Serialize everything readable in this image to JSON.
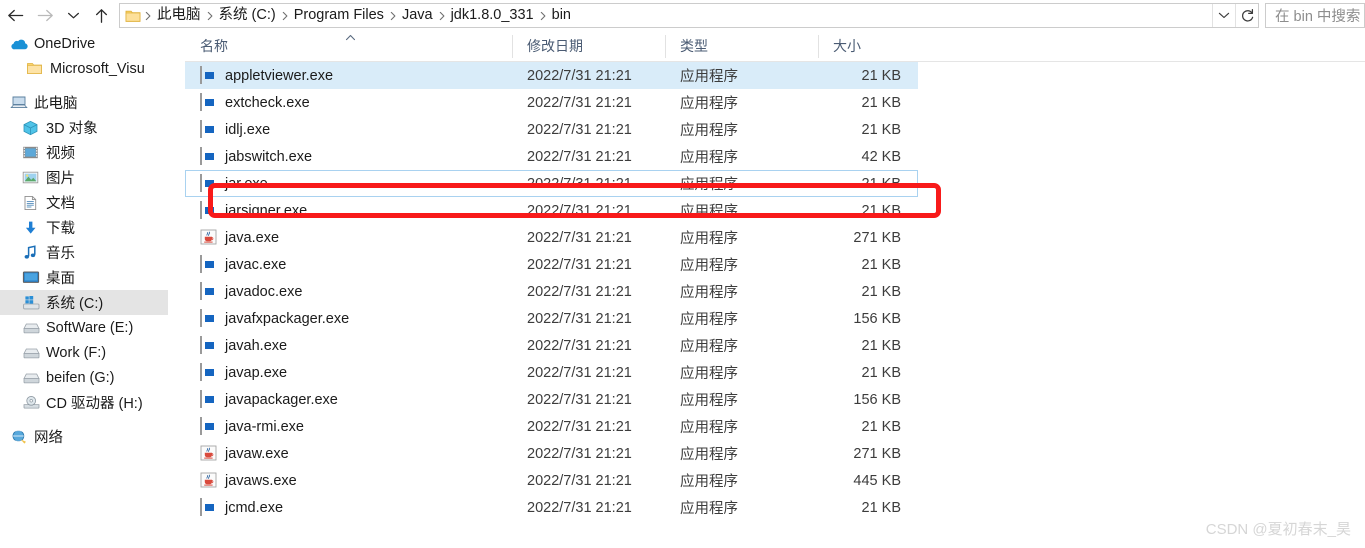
{
  "nav": {
    "back_icon": "arrow-left-icon",
    "forward_icon": "arrow-right-icon",
    "history_icon": "chevron-down-icon",
    "up_icon": "arrow-up-icon",
    "breadcrumbs": [
      "此电脑",
      "系统 (C:)",
      "Program Files",
      "Java",
      "jdk1.8.0_331",
      "bin"
    ],
    "separator": "›",
    "dropdown_icon": "chevron-down-icon",
    "refresh_icon": "refresh-icon"
  },
  "search": {
    "placeholder": "在 bin 中搜索",
    "value": ""
  },
  "sidebar": {
    "groups": [
      {
        "items": [
          {
            "label": "OneDrive",
            "icon": "onedrive-icon",
            "indent": 0,
            "selected": false
          },
          {
            "label": "Microsoft_Visu",
            "icon": "folder-icon",
            "indent": 1,
            "selected": false
          }
        ]
      },
      {
        "items": [
          {
            "label": "此电脑",
            "icon": "this-pc-icon",
            "indent": 0,
            "selected": false
          },
          {
            "label": "3D 对象",
            "icon": "3d-objects-icon",
            "indent": 2,
            "selected": false
          },
          {
            "label": "视频",
            "icon": "videos-icon",
            "indent": 2,
            "selected": false
          },
          {
            "label": "图片",
            "icon": "pictures-icon",
            "indent": 2,
            "selected": false
          },
          {
            "label": "文档",
            "icon": "documents-icon",
            "indent": 2,
            "selected": false
          },
          {
            "label": "下载",
            "icon": "downloads-icon",
            "indent": 2,
            "selected": false
          },
          {
            "label": "音乐",
            "icon": "music-icon",
            "indent": 2,
            "selected": false
          },
          {
            "label": "桌面",
            "icon": "desktop-icon",
            "indent": 2,
            "selected": false
          },
          {
            "label": "系统 (C:)",
            "icon": "windows-drive-icon",
            "indent": 2,
            "selected": true
          },
          {
            "label": "SoftWare (E:)",
            "icon": "drive-icon",
            "indent": 2,
            "selected": false
          },
          {
            "label": "Work (F:)",
            "icon": "drive-icon",
            "indent": 2,
            "selected": false
          },
          {
            "label": "beifen (G:)",
            "icon": "drive-icon",
            "indent": 2,
            "selected": false
          },
          {
            "label": "CD 驱动器 (H:)",
            "icon": "cd-drive-icon",
            "indent": 2,
            "selected": false
          }
        ]
      },
      {
        "items": [
          {
            "label": "网络",
            "icon": "network-icon",
            "indent": 0,
            "selected": false
          }
        ]
      }
    ],
    "scroll_up_icon": "chevron-up-icon",
    "scroll_down_icon": "chevron-down-icon"
  },
  "filelist": {
    "columns": [
      "名称",
      "修改日期",
      "类型",
      "大小"
    ],
    "sort_column": "名称",
    "sort_indicator": "ascending-sort-icon",
    "rows": [
      {
        "name": "appletviewer.exe",
        "date": "2022/7/31 21:21",
        "type": "应用程序",
        "size": "21 KB",
        "icon": "exe-icon",
        "state": "hovered"
      },
      {
        "name": "extcheck.exe",
        "date": "2022/7/31 21:21",
        "type": "应用程序",
        "size": "21 KB",
        "icon": "exe-icon",
        "state": "normal"
      },
      {
        "name": "idlj.exe",
        "date": "2022/7/31 21:21",
        "type": "应用程序",
        "size": "21 KB",
        "icon": "exe-icon",
        "state": "normal"
      },
      {
        "name": "jabswitch.exe",
        "date": "2022/7/31 21:21",
        "type": "应用程序",
        "size": "42 KB",
        "icon": "exe-icon",
        "state": "normal"
      },
      {
        "name": "jar.exe",
        "date": "2022/7/31 21:21",
        "type": "应用程序",
        "size": "21 KB",
        "icon": "exe-icon",
        "state": "selected"
      },
      {
        "name": "jarsigner.exe",
        "date": "2022/7/31 21:21",
        "type": "应用程序",
        "size": "21 KB",
        "icon": "exe-icon",
        "state": "normal"
      },
      {
        "name": "java.exe",
        "date": "2022/7/31 21:21",
        "type": "应用程序",
        "size": "271 KB",
        "icon": "java-icon",
        "state": "normal"
      },
      {
        "name": "javac.exe",
        "date": "2022/7/31 21:21",
        "type": "应用程序",
        "size": "21 KB",
        "icon": "exe-icon",
        "state": "normal"
      },
      {
        "name": "javadoc.exe",
        "date": "2022/7/31 21:21",
        "type": "应用程序",
        "size": "21 KB",
        "icon": "exe-icon",
        "state": "normal"
      },
      {
        "name": "javafxpackager.exe",
        "date": "2022/7/31 21:21",
        "type": "应用程序",
        "size": "156 KB",
        "icon": "exe-icon",
        "state": "normal"
      },
      {
        "name": "javah.exe",
        "date": "2022/7/31 21:21",
        "type": "应用程序",
        "size": "21 KB",
        "icon": "exe-icon",
        "state": "normal"
      },
      {
        "name": "javap.exe",
        "date": "2022/7/31 21:21",
        "type": "应用程序",
        "size": "21 KB",
        "icon": "exe-icon",
        "state": "normal"
      },
      {
        "name": "javapackager.exe",
        "date": "2022/7/31 21:21",
        "type": "应用程序",
        "size": "156 KB",
        "icon": "exe-icon",
        "state": "normal"
      },
      {
        "name": "java-rmi.exe",
        "date": "2022/7/31 21:21",
        "type": "应用程序",
        "size": "21 KB",
        "icon": "exe-icon",
        "state": "normal"
      },
      {
        "name": "javaw.exe",
        "date": "2022/7/31 21:21",
        "type": "应用程序",
        "size": "271 KB",
        "icon": "java-icon",
        "state": "normal"
      },
      {
        "name": "javaws.exe",
        "date": "2022/7/31 21:21",
        "type": "应用程序",
        "size": "445 KB",
        "icon": "java-icon",
        "state": "normal"
      },
      {
        "name": "jcmd.exe",
        "date": "2022/7/31 21:21",
        "type": "应用程序",
        "size": "21 KB",
        "icon": "exe-icon",
        "state": "normal"
      }
    ]
  },
  "annotation": {
    "target_row": "jar.exe",
    "color": "#f81a1a"
  },
  "watermark": {
    "text": "CSDN @夏初春末_昊"
  }
}
